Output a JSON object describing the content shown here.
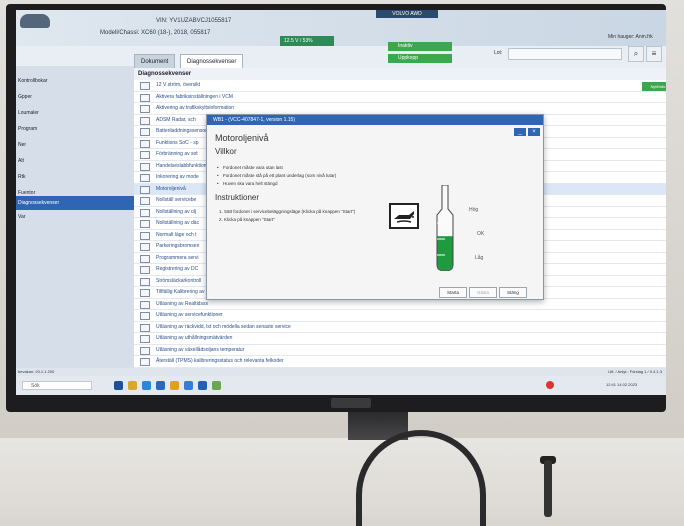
{
  "vehicle": {
    "vin": "VIN: YV1UZABVCJ1055817",
    "model": "Modell/Chassi: XC60 (18-), 2018, 055817"
  },
  "header": {
    "nav_tab": "VOLVO AWD",
    "battery": "12.5 V / 53%",
    "status_1": "Inaktiv",
    "status_2": "Uppkopp",
    "user": "Min hauger: Anm.frk",
    "lot_label": "Lot:",
    "lot_value": "..."
  },
  "tabs": [
    {
      "label": "Dokument"
    },
    {
      "label": "Diagnossekvenser"
    }
  ],
  "sidebar": {
    "items": [
      {
        "label": "Kontrollbokar"
      },
      {
        "label": "Gpper"
      },
      {
        "label": "Loumaler"
      },
      {
        "label": "Program"
      },
      {
        "label": "Ner"
      },
      {
        "label": "Alt"
      },
      {
        "label": "Rtk"
      },
      {
        "label": "Fuentor"
      },
      {
        "label": "Diagnossekvenser"
      },
      {
        "label": "Var"
      }
    ],
    "selected_index": 8
  },
  "main": {
    "header": "Diagnossekvenser",
    "action_button": "Nytt/info",
    "rows": [
      "12 V ström, översikt",
      "Aktivera fabriksinställningen i VCM",
      "Aktivering av trafikskyltsinformation",
      "ADSM Radar, sch",
      "Batteriladdningssensor",
      "Funktions SoC - sp",
      "Förbränning av sot",
      "Handelseslabbfunktion",
      "Inkorering av mode",
      "Motoroljenivå",
      "Nollställ servicebe",
      "Nollställning av olj",
      "Nollställning av däc",
      "Normalt läge och t",
      "Parkeringsbromsen",
      "Programmera servi",
      "Registrering av DC",
      "Strömsläckarkontroll",
      "Tillfällig Kalibrering av Volvo Cars appen",
      "Utläsning av Realtidsss",
      "Utläsning av servicefunktioner",
      "Utläsning av räckvidd, lst och mödella sedan senaste service",
      "Utläsning av uthållningsmätvärden",
      "Utläsning av växellådsoljans temperatur",
      "Återställ (TPMS) kalibreringsstatus och relevanta felkoder"
    ],
    "selected_row": 9
  },
  "dialog": {
    "title": "WB1 - (VCC-407847-1, version 1.15)",
    "heading": "Motoroljenivå",
    "conditions_heading": "Villkor",
    "conditions": [
      "Fordonet måste vara utan last",
      "Fordonet måste stå på ett plant underlag (som nivå lutar)",
      "Huven ska vara helt stängd"
    ],
    "instructions_heading": "Instruktioner",
    "instructions": [
      "1.  Sätt fordonet i servicebeläggningsläge (Klicka på knappen \"Start\")",
      "2.  Klicka på knappen \"Start\""
    ],
    "gauge_labels": {
      "high": "Hög",
      "ok": "OK",
      "low": "Låg"
    },
    "gauge_level": 0.6,
    "buttons": {
      "start": "Starta",
      "next": "Nästa",
      "close": "Stäng"
    }
  },
  "statusbar": {
    "text": "bevakan: 20.1.1.200",
    "right": "Utf. / Anlyt.: Förslag 1 / 0.4.1.3"
  },
  "taskbar": {
    "search": "Sök",
    "tray_time": "12:41 14.02.2023"
  },
  "colors": {
    "accent": "#2f66b3",
    "status_green": "#3aa94e",
    "gauge_green": "#1f9a3f",
    "battery_green": "#2e8b57"
  }
}
